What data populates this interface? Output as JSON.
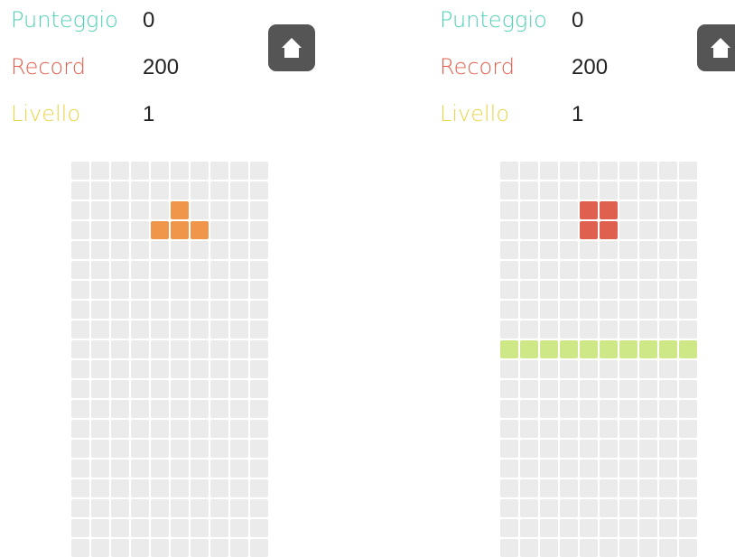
{
  "colors": {
    "score_label": "#4fd1b5",
    "record_label": "#e25d4b",
    "level_label": "#e8d548",
    "empty_cell": "#ebebeb",
    "home_button": "#555555"
  },
  "grid": {
    "columns": 10,
    "rows": 20
  },
  "panels": [
    {
      "score_label": "Punteggio",
      "score_value": "0",
      "record_label": "Record",
      "record_value": "200",
      "level_label": "Livello",
      "level_value": "1",
      "home_icon": "home-icon",
      "filled_cells": [
        {
          "row": 2,
          "col": 5,
          "color": "#f0964a"
        },
        {
          "row": 3,
          "col": 4,
          "color": "#f0964a"
        },
        {
          "row": 3,
          "col": 5,
          "color": "#f0964a"
        },
        {
          "row": 3,
          "col": 6,
          "color": "#f0964a"
        }
      ]
    },
    {
      "score_label": "Punteggio",
      "score_value": "0",
      "record_label": "Record",
      "record_value": "200",
      "level_label": "Livello",
      "level_value": "1",
      "home_icon": "home-icon",
      "filled_cells": [
        {
          "row": 2,
          "col": 4,
          "color": "#e0604f"
        },
        {
          "row": 2,
          "col": 5,
          "color": "#e0604f"
        },
        {
          "row": 3,
          "col": 4,
          "color": "#e0604f"
        },
        {
          "row": 3,
          "col": 5,
          "color": "#e0604f"
        },
        {
          "row": 9,
          "col": 0,
          "color": "#cfe887"
        },
        {
          "row": 9,
          "col": 1,
          "color": "#cfe887"
        },
        {
          "row": 9,
          "col": 2,
          "color": "#cfe887"
        },
        {
          "row": 9,
          "col": 3,
          "color": "#cfe887"
        },
        {
          "row": 9,
          "col": 4,
          "color": "#cfe887"
        },
        {
          "row": 9,
          "col": 5,
          "color": "#cfe887"
        },
        {
          "row": 9,
          "col": 6,
          "color": "#cfe887"
        },
        {
          "row": 9,
          "col": 7,
          "color": "#cfe887"
        },
        {
          "row": 9,
          "col": 8,
          "color": "#cfe887"
        },
        {
          "row": 9,
          "col": 9,
          "color": "#cfe887"
        }
      ]
    }
  ]
}
